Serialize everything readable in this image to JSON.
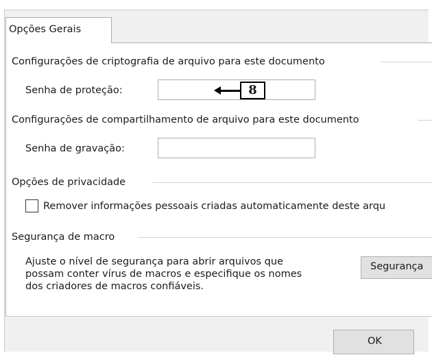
{
  "tab": {
    "label": "Opções Gerais"
  },
  "encryption": {
    "group_label": "Configurações de criptografia de arquivo para este documento",
    "password_label": "Senha de proteção:",
    "password_value": ""
  },
  "callout": {
    "number": "8"
  },
  "sharing": {
    "group_label": "Configurações de compartilhamento de arquivo para este documento",
    "password_label": "Senha de gravação:",
    "password_value": ""
  },
  "privacy": {
    "group_label": "Opções de privacidade",
    "remove_info_label": "Remover informações pessoais criadas automaticamente deste arqu",
    "remove_info_checked": false
  },
  "macro": {
    "group_label": "Segurança de macro",
    "description_lines": [
      "Ajuste o nível de segurança para abrir arquivos que",
      "possam conter vírus de macros e especifique os nomes",
      "dos criadores de macros confiáveis."
    ],
    "security_button_label": "Segurança"
  },
  "footer": {
    "ok_label": "OK"
  }
}
